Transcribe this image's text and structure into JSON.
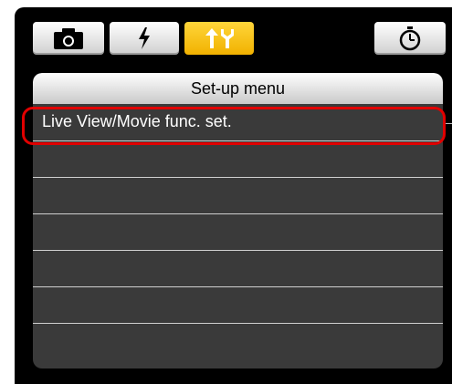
{
  "tabs": [
    {
      "icon": "camera-icon",
      "active": false
    },
    {
      "icon": "flash-icon",
      "active": false
    },
    {
      "icon": "setup-wrench-icon",
      "active": true
    },
    {
      "icon": "stopwatch-icon",
      "active": false
    }
  ],
  "menu": {
    "title": "Set-up menu",
    "items": [
      "Live View/Movie func. set.",
      "",
      "",
      "",
      "",
      "",
      ""
    ]
  },
  "colors": {
    "active_tab": "#f4b800",
    "highlight": "#e10000",
    "panel_background": "#3a3a3a"
  }
}
